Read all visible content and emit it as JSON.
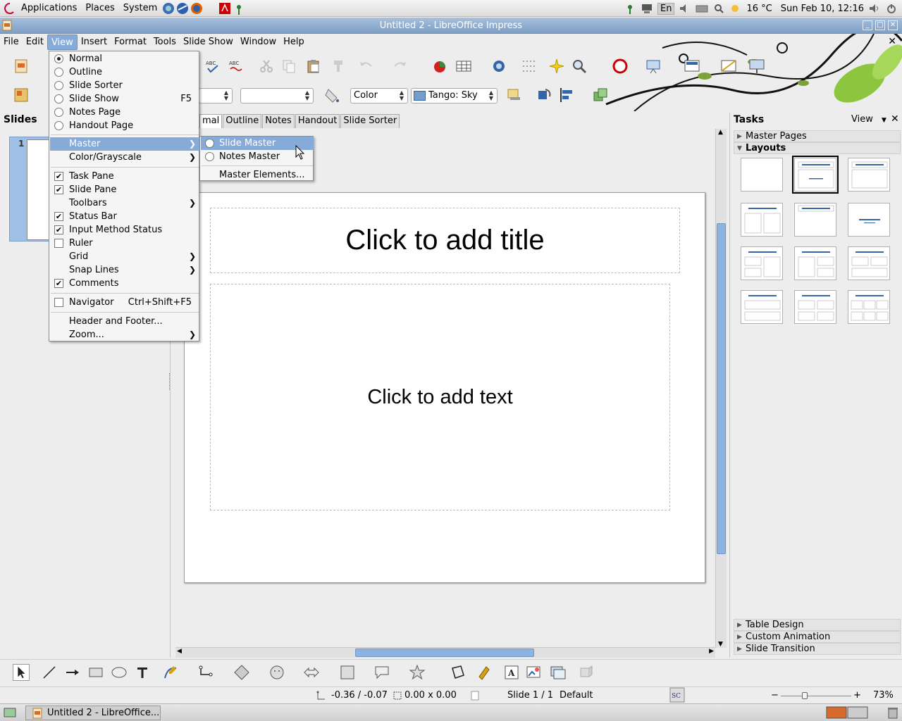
{
  "panel": {
    "applications": "Applications",
    "places": "Places",
    "system": "System",
    "keyboard_layout": "En",
    "weather": "16 °C",
    "clock": "Sun Feb 10, 12:16"
  },
  "window": {
    "title": "Untitled 2 - LibreOffice Impress"
  },
  "menubar": {
    "file": "File",
    "edit": "Edit",
    "view": "View",
    "insert": "Insert",
    "format": "Format",
    "tools": "Tools",
    "slide_show": "Slide Show",
    "window": "Window",
    "help": "Help"
  },
  "format_toolbar": {
    "area_style": "Color",
    "area_color": "Tango: Sky"
  },
  "view_menu": {
    "normal": "Normal",
    "outline": "Outline",
    "slide_sorter": "Slide Sorter",
    "slide_show": "Slide Show",
    "slide_show_shortcut": "F5",
    "notes_page": "Notes Page",
    "handout_page": "Handout Page",
    "master": "Master",
    "color_grayscale": "Color/Grayscale",
    "task_pane": "Task Pane",
    "slide_pane": "Slide Pane",
    "toolbars": "Toolbars",
    "status_bar": "Status Bar",
    "input_method_status": "Input Method Status",
    "ruler": "Ruler",
    "grid": "Grid",
    "snap_lines": "Snap Lines",
    "comments": "Comments",
    "navigator": "Navigator",
    "navigator_shortcut": "Ctrl+Shift+F5",
    "header_footer": "Header and Footer...",
    "zoom": "Zoom..."
  },
  "master_menu": {
    "slide_master": "Slide Master",
    "notes_master": "Notes Master",
    "master_elements": "Master Elements..."
  },
  "slides_pane": {
    "title": "Slides",
    "slide_number": "1"
  },
  "view_tabs": {
    "normal_partial": "mal",
    "outline": "Outline",
    "notes": "Notes",
    "handout": "Handout",
    "slide_sorter": "Slide Sorter"
  },
  "slide": {
    "title_placeholder": "Click to add title",
    "body_placeholder": "Click to add text"
  },
  "tasks_pane": {
    "title": "Tasks",
    "view": "View",
    "close": "✕",
    "master_pages": "Master Pages",
    "layouts": "Layouts",
    "table_design": "Table Design",
    "custom_animation": "Custom Animation",
    "slide_transition": "Slide Transition"
  },
  "statusbar": {
    "position": "-0.36 / -0.07",
    "size": "0.00 x 0.00",
    "slide": "Slide 1 / 1",
    "master": "Default",
    "zoom": "73%"
  },
  "taskbar": {
    "task": "Untitled 2 - LibreOffice..."
  },
  "colors": {
    "highlight": "#86abd9",
    "titlebar": "#7d9ec4",
    "area_color_swatch": "#729fcf"
  }
}
